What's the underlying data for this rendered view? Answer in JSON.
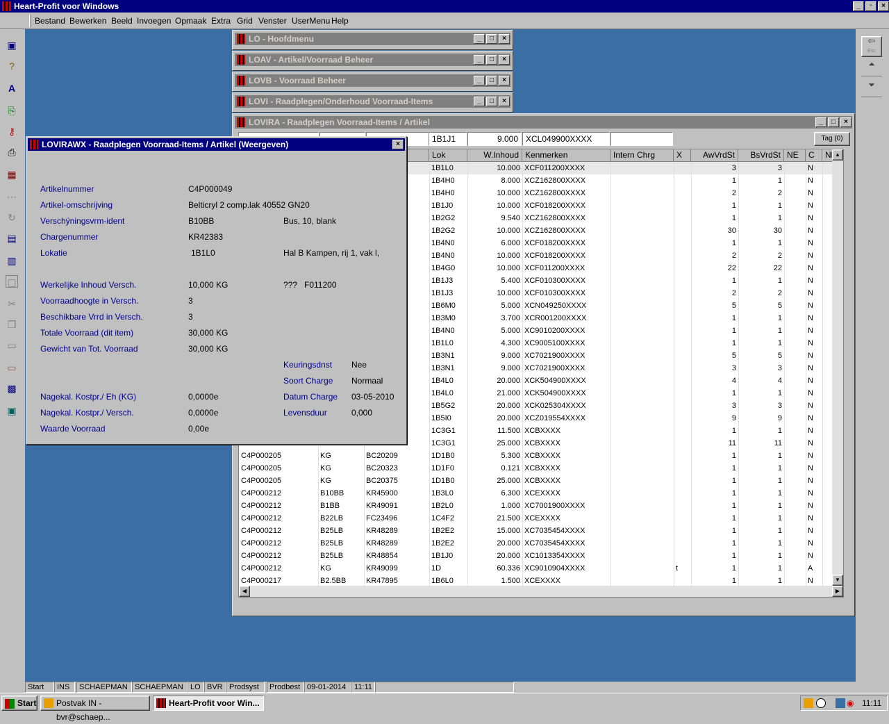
{
  "app": {
    "title": "Heart-Profit voor Windows"
  },
  "menu": [
    "Bestand",
    "Bewerken",
    "Beeld",
    "Invoegen",
    "Opmaak",
    "Extra",
    "Grid",
    "Venster",
    "UserMenu",
    "Help"
  ],
  "left_toolbar": [
    "new-doc-icon",
    "help-icon",
    "spell-icon",
    "export-icon",
    "key-icon",
    "print-icon",
    "calc-icon",
    "link-icon",
    "refresh-icon",
    "form-icon",
    "report-icon",
    "window-icon",
    "cut-icon",
    "copy-icon",
    "paste-icon",
    "paste-special-icon",
    "properties-icon",
    "preview-icon"
  ],
  "right_toolbar": {
    "esc": "Esc"
  },
  "windows": {
    "lo": "LO - Hoofdmenu",
    "loav": "LOAV - Artikel/Voorraad Beheer",
    "lovb": "LOVB - Voorraad Beheer",
    "lovi": "LOVI - Raadplegen/Onderhoud Voorraad-Items",
    "lovira": "LOVIRA - Raadplegen Voorraad-Items / Artikel"
  },
  "filter": {
    "lok": "1B1J1",
    "inhoud": "9.000",
    "kenmerken": "XCL049900XXXX",
    "tag_button": "Tag (0)"
  },
  "grid": {
    "columns": [
      "Lok",
      "W.Inhoud",
      "Kenmerken",
      "Intern Chrg",
      "X",
      "AwVrdSt",
      "BsVrdSt",
      "NE",
      "C",
      "Nl"
    ],
    "top_rows": [
      [
        "1B1L0",
        "10.000",
        "XCF011200XXXX",
        "",
        "",
        "3",
        "3",
        "",
        "N"
      ],
      [
        "1B4H0",
        "8.000",
        "XCZ162800XXXX",
        "",
        "",
        "1",
        "1",
        "",
        "N"
      ],
      [
        "1B4H0",
        "10.000",
        "XCZ162800XXXX",
        "",
        "",
        "2",
        "2",
        "",
        "N"
      ],
      [
        "1B1J0",
        "10.000",
        "XCF018200XXXX",
        "",
        "",
        "1",
        "1",
        "",
        "N"
      ],
      [
        "1B2G2",
        "9.540",
        "XCZ162800XXXX",
        "",
        "",
        "1",
        "1",
        "",
        "N"
      ],
      [
        "1B2G2",
        "10.000",
        "XCZ162800XXXX",
        "",
        "",
        "30",
        "30",
        "",
        "N"
      ],
      [
        "1B4N0",
        "6.000",
        "XCF018200XXXX",
        "",
        "",
        "1",
        "1",
        "",
        "N"
      ],
      [
        "1B4N0",
        "10.000",
        "XCF018200XXXX",
        "",
        "",
        "2",
        "2",
        "",
        "N"
      ],
      [
        "1B4G0",
        "10.000",
        "XCF011200XXXX",
        "",
        "",
        "22",
        "22",
        "",
        "N"
      ],
      [
        "1B1J3",
        "5.400",
        "XCF010300XXXX",
        "",
        "",
        "1",
        "1",
        "",
        "N"
      ],
      [
        "1B1J3",
        "10.000",
        "XCF010300XXXX",
        "",
        "",
        "2",
        "2",
        "",
        "N"
      ],
      [
        "1B6M0",
        "5.000",
        "XCN049250XXXX",
        "",
        "",
        "5",
        "5",
        "",
        "N"
      ],
      [
        "1B3M0",
        "3.700",
        "XCR001200XXXX",
        "",
        "",
        "1",
        "1",
        "",
        "N"
      ],
      [
        "1B4N0",
        "5.000",
        "XC9010200XXXX",
        "",
        "",
        "1",
        "1",
        "",
        "N"
      ],
      [
        "1B1L0",
        "4.300",
        "XC9005100XXXX",
        "",
        "",
        "1",
        "1",
        "",
        "N"
      ],
      [
        "1B3N1",
        "9.000",
        "XC7021900XXXX",
        "",
        "",
        "5",
        "5",
        "",
        "N"
      ],
      [
        "1B3N1",
        "9.000",
        "XC7021900XXXX",
        "",
        "",
        "3",
        "3",
        "",
        "N"
      ],
      [
        "1B4L0",
        "20.000",
        "XCK504900XXXX",
        "",
        "",
        "4",
        "4",
        "",
        "N"
      ],
      [
        "1B4L0",
        "21.000",
        "XCK504900XXXX",
        "",
        "",
        "1",
        "1",
        "",
        "N"
      ],
      [
        "1B5G2",
        "20.000",
        "XCK025304XXXX",
        "",
        "",
        "3",
        "3",
        "",
        "N"
      ],
      [
        "1B5I0",
        "20.000",
        "XCZ019554XXXX",
        "",
        "",
        "9",
        "9",
        "",
        "N"
      ],
      [
        "1C3G1",
        "11.500",
        "XCBXXXX",
        "",
        "",
        "1",
        "1",
        "",
        "N"
      ],
      [
        "1C3G1",
        "25.000",
        "XCBXXXX",
        "",
        "",
        "11",
        "11",
        "",
        "N"
      ]
    ],
    "bottom_rows": [
      [
        "C4P000205",
        "KG",
        "BC20209",
        "1D1B0",
        "5.300",
        "XCBXXXX",
        "",
        "",
        "1",
        "1",
        "",
        "N"
      ],
      [
        "C4P000205",
        "KG",
        "BC20323",
        "1D1F0",
        "0.121",
        "XCBXXXX",
        "",
        "",
        "1",
        "1",
        "",
        "N"
      ],
      [
        "C4P000205",
        "KG",
        "BC20375",
        "1D1B0",
        "25.000",
        "XCBXXXX",
        "",
        "",
        "1",
        "1",
        "",
        "N"
      ],
      [
        "C4P000212",
        "B10BB",
        "KR45900",
        "1B3L0",
        "6.300",
        "XCEXXXX",
        "",
        "",
        "1",
        "1",
        "",
        "N"
      ],
      [
        "C4P000212",
        "B1BB",
        "KR49091",
        "1B2L0",
        "1.000",
        "XC7001900XXXX",
        "",
        "",
        "1",
        "1",
        "",
        "N"
      ],
      [
        "C4P000212",
        "B22LB",
        "FC23496",
        "1C4F2",
        "21.500",
        "XCEXXXX",
        "",
        "",
        "1",
        "1",
        "",
        "N"
      ],
      [
        "C4P000212",
        "B25LB",
        "KR48289",
        "1B2E2",
        "15.000",
        "XC7035454XXXX",
        "",
        "",
        "1",
        "1",
        "",
        "N"
      ],
      [
        "C4P000212",
        "B25LB",
        "KR48289",
        "1B2E2",
        "20.000",
        "XC7035454XXXX",
        "",
        "",
        "1",
        "1",
        "",
        "N"
      ],
      [
        "C4P000212",
        "B25LB",
        "KR48854",
        "1B1J0",
        "20.000",
        "XC1013354XXXX",
        "",
        "",
        "1",
        "1",
        "",
        "N"
      ],
      [
        "C4P000212",
        "KG",
        "KR49099",
        "1D",
        "60.336",
        "XC9010904XXXX",
        "",
        "t",
        "1",
        "1",
        "",
        "A"
      ],
      [
        "C4P000217",
        "B2.5BB",
        "KR47895",
        "1B6L0",
        "1.500",
        "XCEXXXX",
        "",
        "",
        "1",
        "1",
        "",
        "N"
      ]
    ]
  },
  "dialog": {
    "title": "LOVIRAWX - Raadplegen Voorraad-Items / Artikel (Weergeven)",
    "artikelnummer_label": "Artikelnummer",
    "artikelnummer": "C4P000049",
    "omschrijving_label": "Artikel-omschrijving",
    "omschrijving": "Belticryl 2 comp.lak 40552 GN20",
    "vorm_label": "Verschÿningsvrm-ident",
    "vorm": "B10BB",
    "vorm_desc": "Bus, 10, blank",
    "charge_label": "Chargenummer",
    "charge": "KR42383",
    "lokatie_label": "Lokatie",
    "lokatie": "1B1L0",
    "lokatie_desc": "Hal B Kampen, rij 1, vak l,",
    "inhoud_label": "Werkelijke Inhoud Versch.",
    "inhoud": "10,000 KG",
    "inhoud_code": "???   F011200",
    "hoogte_label": "Voorraadhoogte in Versch.",
    "hoogte": "3",
    "beschikbaar_label": "Beschikbare Vrrd in Versch.",
    "beschikbaar": "3",
    "totaal_label": "Totale Voorraad (dit item)",
    "totaal": "30,000 KG",
    "gewicht_label": "Gewicht van Tot. Voorraad",
    "gewicht": "30,000 KG",
    "keuring_label": "Keuringsdnst",
    "keuring": "Nee",
    "soort_label": "Soort Charge",
    "soort": "Normaal",
    "datum_label": "Datum Charge",
    "datum": "03-05-2010",
    "leven_label": "Levensduur",
    "leven": "0,000",
    "kostpr_eh_label": "Nagekal. Kostpr./ Eh (KG)",
    "kostpr_eh": "0,0000e",
    "kostpr_v_label": "Nagekal. Kostpr./ Versch.",
    "kostpr_v": "0,0000e",
    "waarde_label": "Waarde Voorraad",
    "waarde": "0,00e"
  },
  "status": [
    "Start",
    "INS",
    "SCHAEPMAN",
    "SCHAEPMAN",
    "LO",
    "BVR",
    "Prodsyst",
    "Prodbest",
    "09-01-2014",
    "11:11"
  ],
  "taskbar": {
    "start": "Start",
    "task1": "Postvak IN - bvr@schaep...",
    "task2": "Heart-Profit voor Win...",
    "clock": "11:11"
  }
}
